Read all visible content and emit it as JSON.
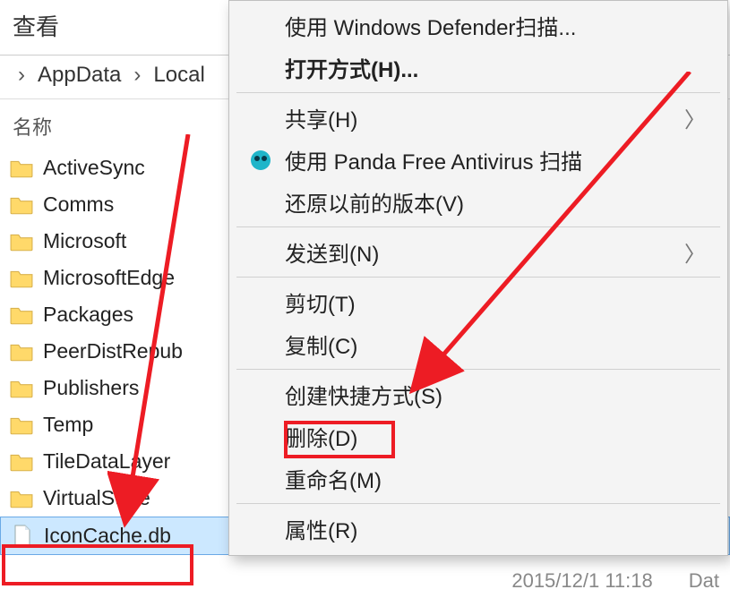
{
  "menubar": {
    "view": "查看"
  },
  "breadcrumbs": {
    "sep1": "›",
    "item1": "AppData",
    "sep2": "›",
    "item2": "Local"
  },
  "columns": {
    "name": "名称"
  },
  "files": [
    {
      "label": "ActiveSync"
    },
    {
      "label": "Comms"
    },
    {
      "label": "Microsoft"
    },
    {
      "label": "MicrosoftEdge"
    },
    {
      "label": "Packages"
    },
    {
      "label": "PeerDistRepub"
    },
    {
      "label": "Publishers"
    },
    {
      "label": "Temp"
    },
    {
      "label": "TileDataLayer"
    },
    {
      "label": "VirtualStore"
    },
    {
      "label": "IconCache.db"
    }
  ],
  "ctx": {
    "defender": "使用 Windows Defender扫描...",
    "open_with": "打开方式(H)...",
    "share": "共享(H)",
    "panda": "使用 Panda Free Antivirus 扫描",
    "restore": "还原以前的版本(V)",
    "send_to": "发送到(N)",
    "cut": "剪切(T)",
    "copy": "复制(C)",
    "shortcut": "创建快捷方式(S)",
    "delete": "删除(D)",
    "rename": "重命名(M)",
    "properties": "属性(R)"
  },
  "status": {
    "date": "2015/12/1 11:18",
    "type_label": "Dat"
  }
}
